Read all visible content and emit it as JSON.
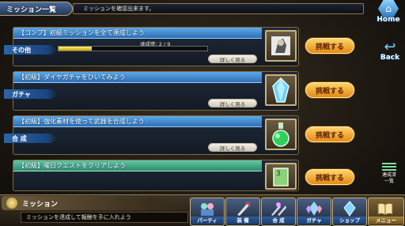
{
  "header": {
    "title": "ミッション一覧",
    "message": "ミッションを確認出来ます。"
  },
  "side": {
    "home_label": "Home",
    "back_label": "Back",
    "done_label_line1": "達成済",
    "done_label_line2": "一覧"
  },
  "missions": [
    {
      "title": "【コンプ】初級ミッションを全て達成しよう",
      "category": "その他",
      "progress_label": "達成度:  2 /  9",
      "progress_current": 2,
      "progress_total": 9,
      "detail_label": "詳しく見る",
      "challenge_label": "挑戦する",
      "thumb_icon": "character-portrait-icon"
    },
    {
      "title": "【初級】ダイヤガチャをひいてみよう",
      "category": "ガチャ",
      "detail_label": "詳しく見る",
      "challenge_label": "挑戦する",
      "thumb_icon": "blue-crystal-icon"
    },
    {
      "title": "【初級】強化素材を使って武器を合成しよう",
      "category": "合 成",
      "detail_label": "詳しく見る",
      "challenge_label": "挑戦する",
      "thumb_icon": "green-potion-icon"
    },
    {
      "title": "【初級】曜日クエストをクリアしよう",
      "challenge_label": "挑戦する",
      "thumb_icon": "green-scroll-icon"
    }
  ],
  "bottom": {
    "section_title": "ミッション",
    "description": "ミッションを達成して報酬を手に入れよう"
  },
  "nav": [
    {
      "label": "パーティ",
      "icon": "party-icon"
    },
    {
      "label": "装 備",
      "icon": "equipment-icon"
    },
    {
      "label": "合 成",
      "icon": "synthesis-icon"
    },
    {
      "label": "ガチャ",
      "icon": "gacha-icon"
    },
    {
      "label": "ショップ",
      "icon": "shop-icon"
    },
    {
      "label": "メニュー",
      "icon": "menu-book-icon"
    }
  ],
  "colors": {
    "title_blue": "#2c70b6",
    "title_green": "#2c8c6c",
    "challenge_orange": "#e48a12",
    "progress_yellow": "#fff27a"
  }
}
